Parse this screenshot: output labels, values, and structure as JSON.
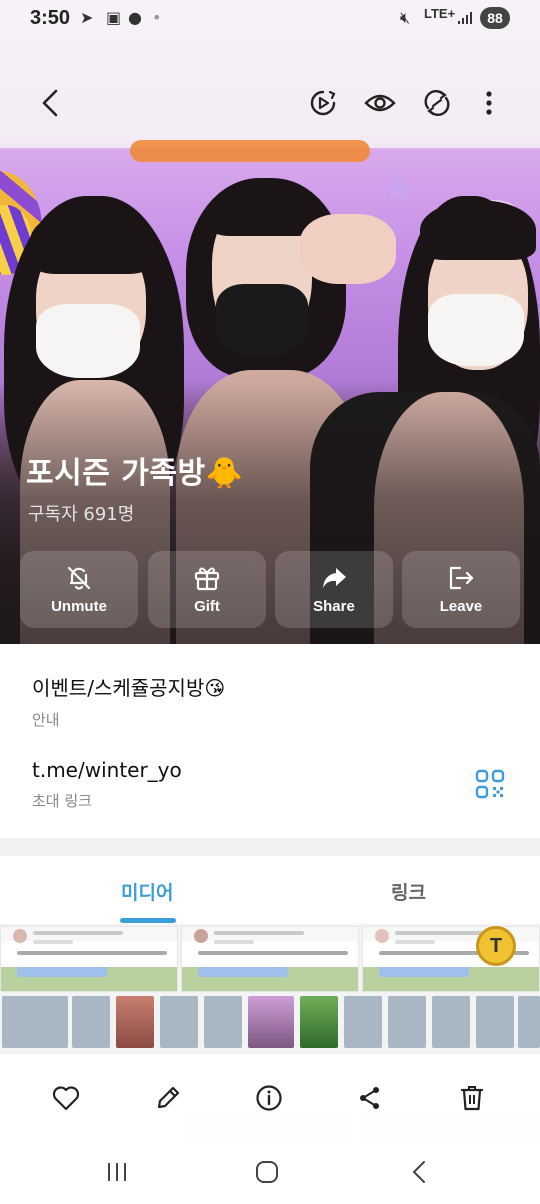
{
  "status_bar": {
    "time": "3:50",
    "network": "LTE+",
    "battery": "88"
  },
  "toolbar": {
    "icons": [
      "back-arrow-icon",
      "video-chat-icon",
      "eye-icon",
      "rotate-icon",
      "more-vertical-icon"
    ]
  },
  "channel": {
    "title": "포시즌 가족방🐥",
    "subscribers": "구독자 691명"
  },
  "actions": [
    {
      "label": "Unmute",
      "icon": "bell-off-icon"
    },
    {
      "label": "Gift",
      "icon": "gift-icon"
    },
    {
      "label": "Share",
      "icon": "share-arrow-icon"
    },
    {
      "label": "Leave",
      "icon": "leave-icon"
    }
  ],
  "info": {
    "description": "이벤트/스케쥴공지방😘",
    "description_label": "안내",
    "link": "t.me/winter_yo",
    "link_label": "초대 링크"
  },
  "tabs": [
    {
      "label": "미디어",
      "active": true
    },
    {
      "label": "링크",
      "active": false
    }
  ],
  "colors": {
    "accent": "#3c9ed9",
    "hero_purple": "#c58fe6",
    "qr_icon": "#3c9ed9"
  },
  "bottom_bar": {
    "icons": [
      "heart-icon",
      "edit-pencil-icon",
      "info-icon",
      "share-icon",
      "trash-icon"
    ]
  },
  "nav_bar": {
    "icons": [
      "recent-apps-icon",
      "home-icon",
      "back-icon"
    ]
  }
}
